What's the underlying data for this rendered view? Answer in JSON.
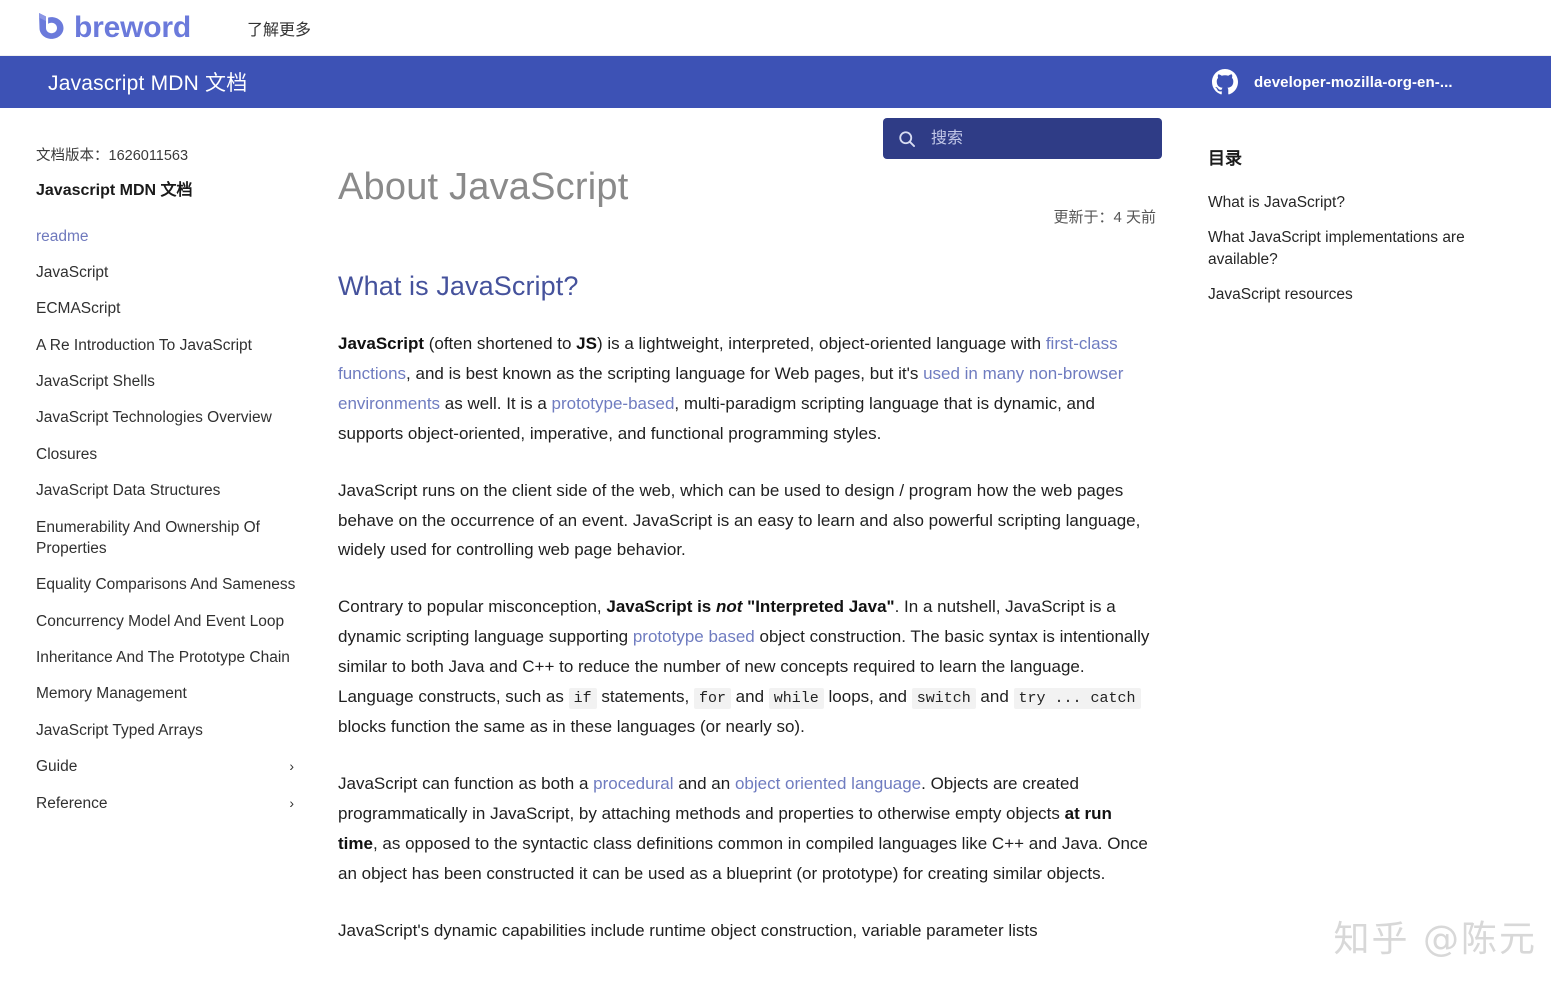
{
  "brand": {
    "logo_text": "breword",
    "logo_color": "#6b7adb",
    "learn_more": "了解更多"
  },
  "navbar": {
    "title": "Javascript MDN 文档",
    "background": "#3d52b5",
    "search": {
      "placeholder": "搜索",
      "value": "",
      "icon": "search-icon",
      "background": "#2f3c86"
    },
    "repo": {
      "icon": "github-icon",
      "name": "developer-mozilla-org-en-..."
    }
  },
  "sidebar": {
    "doc_version_label": "文档版本：1626011563",
    "title": "Javascript MDN 文档",
    "items": [
      {
        "label": "readme",
        "active": true,
        "expandable": false
      },
      {
        "label": "JavaScript",
        "active": false,
        "expandable": false
      },
      {
        "label": "ECMAScript",
        "active": false,
        "expandable": false
      },
      {
        "label": "A Re Introduction To JavaScript",
        "active": false,
        "expandable": false
      },
      {
        "label": "JavaScript Shells",
        "active": false,
        "expandable": false
      },
      {
        "label": "JavaScript Technologies Overview",
        "active": false,
        "expandable": false
      },
      {
        "label": "Closures",
        "active": false,
        "expandable": false
      },
      {
        "label": "JavaScript Data Structures",
        "active": false,
        "expandable": false
      },
      {
        "label": "Enumerability And Ownership Of Properties",
        "active": false,
        "expandable": false
      },
      {
        "label": "Equality Comparisons And Sameness",
        "active": false,
        "expandable": false
      },
      {
        "label": "Concurrency Model And Event Loop",
        "active": false,
        "expandable": false
      },
      {
        "label": "Inheritance And The Prototype Chain",
        "active": false,
        "expandable": false
      },
      {
        "label": "Memory Management",
        "active": false,
        "expandable": false
      },
      {
        "label": "JavaScript Typed Arrays",
        "active": false,
        "expandable": false
      },
      {
        "label": "Guide",
        "active": false,
        "expandable": true,
        "chevron": "chevron-right-icon"
      },
      {
        "label": "Reference",
        "active": false,
        "expandable": true,
        "chevron": "chevron-right-icon"
      }
    ]
  },
  "main": {
    "updated": "更新于：4 天前",
    "page_title": "About JavaScript",
    "section_heading": "What is JavaScript?",
    "paragraphs": {
      "p1": {
        "t1": "JavaScript",
        "t2": " (often shortened to ",
        "t3": "JS",
        "t4": ") is a lightweight, interpreted, object-oriented language with ",
        "l1": "first-class functions",
        "t5": ", and is best known as the scripting language for Web pages, but it's ",
        "l2": "used in many non-browser environments",
        "t6": " as well. It is a ",
        "l3": "prototype-based",
        "t7": ", multi-paradigm scripting language that is dynamic, and supports object-oriented, imperative, and functional programming styles."
      },
      "p2": "JavaScript runs on the client side of the web, which can be used to design / program how the web pages behave on the occurrence of an event. JavaScript is an easy to learn and also powerful scripting language, widely used for controlling web page behavior.",
      "p3": {
        "t1": "Contrary to popular misconception, ",
        "b1": "JavaScript is ",
        "i1": "not",
        "b2": " \"Interpreted Java\"",
        "t2": ". In a nutshell, JavaScript is a dynamic scripting language supporting ",
        "l1": "prototype based",
        "t3": " object construction. The basic syntax is intentionally similar to both Java and C++ to reduce the number of new concepts required to learn the language. Language constructs, such as ",
        "c1": "if",
        "t4": " statements, ",
        "c2": "for",
        "t5": " and ",
        "c3": "while",
        "t6": " loops, and ",
        "c4": "switch",
        "t7": " and ",
        "c5": "try ... catch",
        "t8": " blocks function the same as in these languages (or nearly so)."
      },
      "p4": {
        "t1": "JavaScript can function as both a ",
        "l1": "procedural",
        "t2": " and an ",
        "l2": "object oriented language",
        "t3": ". Objects are created programmatically in JavaScript, by attaching methods and properties to otherwise empty objects ",
        "b1": "at run time",
        "t4": ", as opposed to the syntactic class definitions common in compiled languages like C++ and Java. Once an object has been constructed it can be used as a blueprint (or prototype) for creating similar objects."
      },
      "p5": "JavaScript's dynamic capabilities include runtime object construction, variable parameter lists"
    }
  },
  "toc": {
    "title": "目录",
    "items": [
      {
        "label": "What is JavaScript?"
      },
      {
        "label": "What JavaScript implementations are available?"
      },
      {
        "label": "JavaScript resources"
      }
    ]
  },
  "watermark": {
    "text": "知乎 @陈元"
  }
}
